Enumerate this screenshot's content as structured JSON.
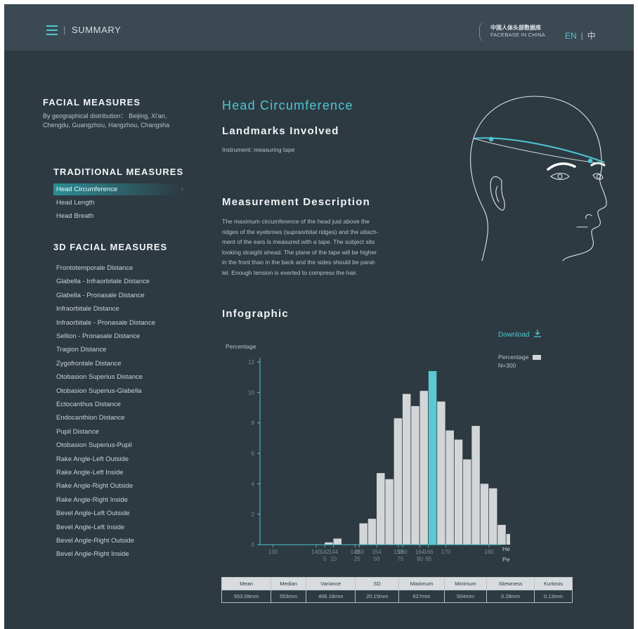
{
  "header": {
    "menu_icon": "hamburger-menu-icon",
    "separator": "|",
    "title": "SUMMARY",
    "brand_cn": "中国人体头部数据库",
    "brand_en": "FACEBASE IN CHINA",
    "lang_en": "EN",
    "lang_sep": "|",
    "lang_zh": "中",
    "accent_color": "#4fc7d2"
  },
  "sidebar": {
    "facial_title": "FACIAL MEASURES",
    "facial_desc": "By geographical distribution： Beijing, Xi'an, Chengdu, Guangzhou, Hangzhou, Changsha",
    "traditional_title": "TRADITIONAL MEASURES",
    "traditional_items": [
      {
        "label": "Head Circumference",
        "active": true
      },
      {
        "label": "Head Length",
        "active": false
      },
      {
        "label": "Head Breath",
        "active": false
      }
    ],
    "measures3d_title": "3D FACIAL MEASURES",
    "measures3d_items": [
      "Frontotemporale Distance",
      "Glabella - Infraorbitale Distance",
      "Glabella - Pronasale Distance",
      "Infraorbitale Distance",
      "Infraorbitale - Pronasale Distance",
      "Sellion - Pronasale Distance",
      "Tragion Distance",
      "Zygofrontale Distance",
      "Otobasion Superius Distance",
      "Otobasion Superius-Glabella",
      "Ectocanthus Distance",
      "Endocanthion Distance",
      "Pupil Distance",
      "Otobasion Superius-Pupil",
      "Rake Angle-Left Outside",
      "Rake Angle-Left Inside",
      "Rake Angle-Right Outside",
      "Rake Angle-Right Inside",
      "Bevel Angle-Left Outside",
      "Bevel Angle-Left Inside",
      "Bevel Angle-Right Outside",
      "Bevel Angle-Right Inside"
    ]
  },
  "main": {
    "title": "Head Circumference",
    "landmarks_title": "Landmarks Involved",
    "instrument": "Instrument: measuring tape",
    "description_title": "Measurement Description",
    "description_lines": [
      "The maximum circumference of the head just above the",
      "ridges of the eyebrows (supraorbital ridges) and the attach-",
      "ment of the ears is measured with a tape.  The subject sits",
      "looking straight ahead.  The plane of the tape will be higher",
      "in the front than in the back and the sides should be paral-",
      "lel. Enough tension is exerted to compress the hair."
    ],
    "infographic_title": "Infographic",
    "download_label": "Download",
    "download_icon": "download-icon",
    "legend_label": "Percentage",
    "legend_n": "N=300",
    "head_illustration": "head-measurement-illustration"
  },
  "chart_data": {
    "type": "bar",
    "ylabel": "Percentage",
    "xlabel": "Head Circumference(mm)",
    "x2label": "Percentile",
    "ylim": [
      0,
      12
    ],
    "yticks": [
      0,
      2,
      4,
      6,
      8,
      10,
      12
    ],
    "xlim": [
      127,
      183
    ],
    "bin_width": 2,
    "x_start": 126,
    "bins_values": [
      0,
      0,
      0,
      0,
      0,
      0,
      0,
      0,
      0.15,
      0.4,
      0,
      0,
      1.4,
      1.7,
      4.7,
      4.3,
      8.3,
      9.9,
      9.1,
      10.1,
      11.4,
      9.4,
      7.5,
      6.9,
      5.6,
      7.8,
      4.0,
      3.7,
      1.3,
      0.7,
      0.4,
      0.7
    ],
    "highlight_bin_index": 20,
    "highlight_color": "#5bc8d4",
    "bar_color": "#d3d6d8",
    "x_tick_labels": [
      {
        "x": 130,
        "label": "130"
      },
      {
        "x": 140,
        "label": "140"
      },
      {
        "x": 142,
        "label": "142"
      },
      {
        "x": 144,
        "label": "144"
      },
      {
        "x": 149,
        "label": "149"
      },
      {
        "x": 150,
        "label": "150"
      },
      {
        "x": 154,
        "label": "154"
      },
      {
        "x": 159,
        "label": "159"
      },
      {
        "x": 160,
        "label": "160"
      },
      {
        "x": 164,
        "label": "164"
      },
      {
        "x": 166,
        "label": "166"
      },
      {
        "x": 170,
        "label": "170"
      },
      {
        "x": 180,
        "label": "180"
      }
    ],
    "percentile_labels": [
      {
        "x": 142,
        "label": "5"
      },
      {
        "x": 144,
        "label": "10"
      },
      {
        "x": 149.5,
        "label": "25"
      },
      {
        "x": 154,
        "label": "50"
      },
      {
        "x": 159.5,
        "label": "75"
      },
      {
        "x": 164,
        "label": "90"
      },
      {
        "x": 166,
        "label": "95"
      }
    ]
  },
  "stats": {
    "headers": [
      "Mean",
      "Median",
      "Variance",
      "SD",
      "Maximum",
      "Minimum",
      "Skewness",
      "Kurtosis"
    ],
    "values": [
      "553.09mm",
      "553mm",
      "406.18mm",
      "20.15mm",
      "627mm",
      "504mm",
      "0.28mm",
      "0.13mm"
    ]
  }
}
